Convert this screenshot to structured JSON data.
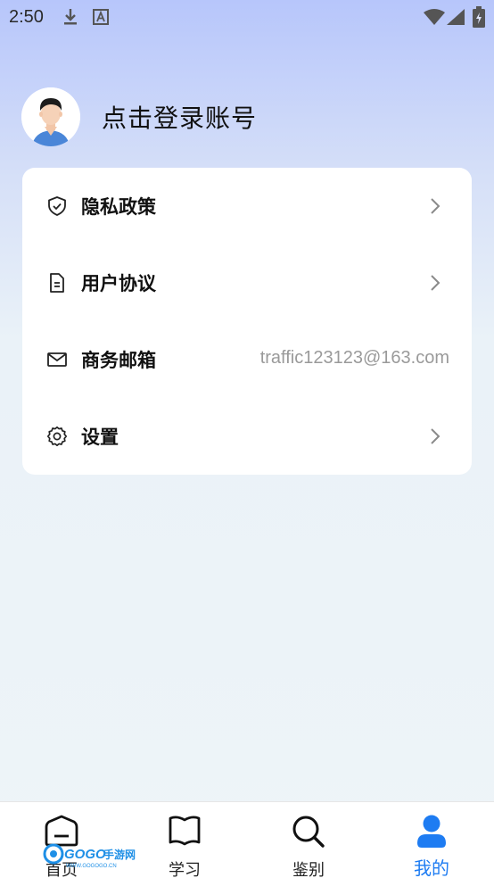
{
  "status_bar": {
    "time": "2:50",
    "icons": [
      "download-icon",
      "text-notification-icon",
      "wifi-icon",
      "signal-icon",
      "battery-icon"
    ]
  },
  "profile": {
    "login_text": "点击登录账号"
  },
  "menu": {
    "items": [
      {
        "label": "隐私政策",
        "icon": "shield-check-icon",
        "value": "",
        "has_arrow": true
      },
      {
        "label": "用户协议",
        "icon": "document-icon",
        "value": "",
        "has_arrow": true
      },
      {
        "label": "商务邮箱",
        "icon": "mail-icon",
        "value": "traffic123123@163.com",
        "has_arrow": false
      },
      {
        "label": "设置",
        "icon": "gear-icon",
        "value": "",
        "has_arrow": true
      }
    ]
  },
  "bottom_nav": {
    "items": [
      {
        "label": "首页",
        "icon": "home-icon",
        "active": false
      },
      {
        "label": "学习",
        "icon": "book-icon",
        "active": false
      },
      {
        "label": "鉴别",
        "icon": "search-icon",
        "active": false
      },
      {
        "label": "我的",
        "icon": "user-icon",
        "active": true
      }
    ]
  },
  "watermark": {
    "text": "GOGO手游网",
    "subtext": "WWW.GOGOGO.CN"
  },
  "colors": {
    "accent": "#1e7cf2",
    "card_bg": "#ffffff",
    "value_text": "#9a9a9a"
  }
}
